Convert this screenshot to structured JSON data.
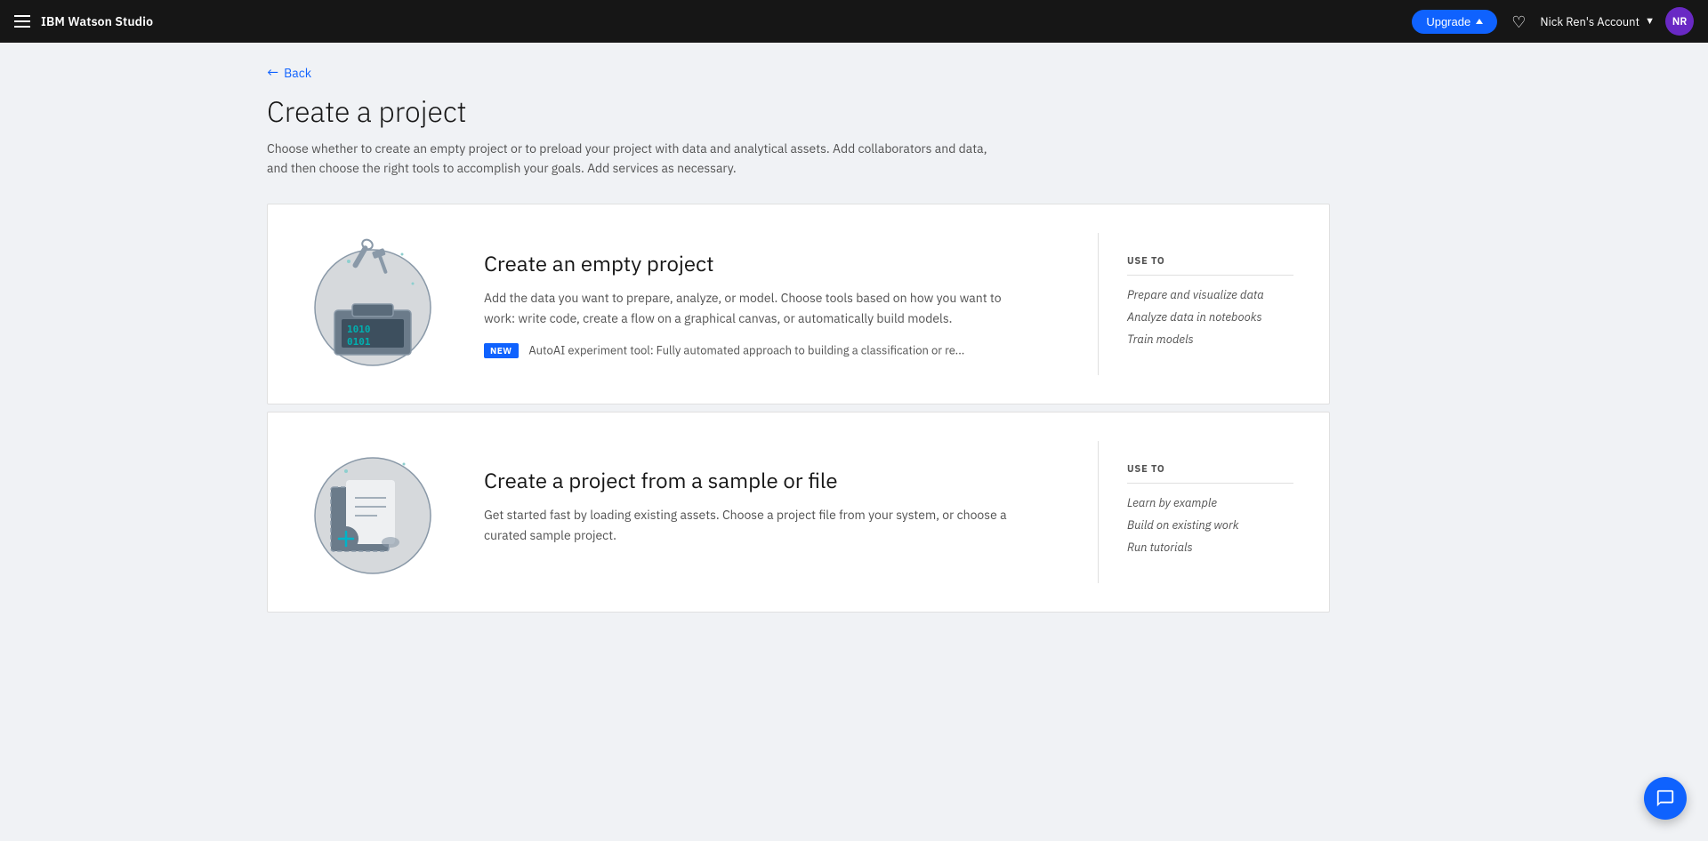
{
  "app": {
    "title": "IBM Watson Studio"
  },
  "nav": {
    "upgrade_label": "Upgrade",
    "account_name": "Nick Ren's Account",
    "avatar_initials": "NR"
  },
  "page": {
    "back_label": "Back",
    "title": "Create a project",
    "description": "Choose whether to create an empty project or to preload your project with data and analytical assets. Add collaborators and data, and then choose the right tools to accomplish your goals. Add services as necessary."
  },
  "cards": [
    {
      "id": "empty",
      "title": "Create an empty project",
      "description": "Add the data you want to prepare, analyze, or model. Choose tools based on how you want to work: write code, create a flow on a graphical canvas, or automatically build models.",
      "badge_label": "NEW",
      "badge_text": "AutoAI experiment tool: Fully automated approach to building a classification or re...",
      "use_to_title": "USE TO",
      "use_to_items": [
        "Prepare and visualize data",
        "Analyze data in notebooks",
        "Train models"
      ]
    },
    {
      "id": "sample",
      "title": "Create a project from a sample or file",
      "description": "Get started fast by loading existing assets. Choose a project file from your system, or choose a curated sample project.",
      "badge_label": "",
      "badge_text": "",
      "use_to_title": "USE TO",
      "use_to_items": [
        "Learn by example",
        "Build on existing work",
        "Run tutorials"
      ]
    }
  ]
}
